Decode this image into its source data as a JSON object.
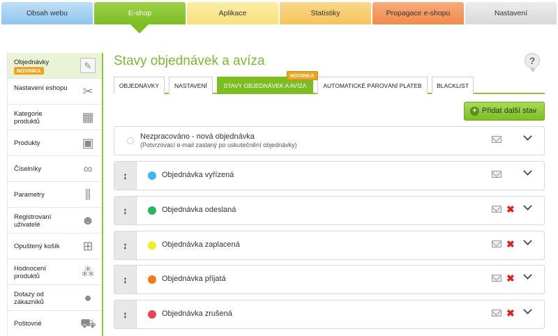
{
  "topnav": [
    {
      "label": "Obsah webu",
      "color": "#8fc4ee"
    },
    {
      "label": "E-shop",
      "color": "#7cbe22",
      "active": true
    },
    {
      "label": "Aplikace",
      "color": "#f7e07a"
    },
    {
      "label": "Statistiky",
      "color": "#f6c45a"
    },
    {
      "label": "Propagace e-shopu",
      "color": "#f28a4c"
    },
    {
      "label": "Nastavení",
      "color": "#d9d9d9"
    }
  ],
  "sidebar": {
    "badge": "NOVINKA",
    "items": [
      {
        "label": "Objednávky",
        "icon": "edit-icon"
      },
      {
        "label": "Nastavení eshopu",
        "icon": "tools-icon"
      },
      {
        "label": "Kategorie produktů",
        "icon": "boxes-icon"
      },
      {
        "label": "Produkty",
        "icon": "product-icon"
      },
      {
        "label": "Číselníky",
        "icon": "binoculars-icon"
      },
      {
        "label": "Parametry",
        "icon": "sliders-icon"
      },
      {
        "label": "Registrovaní uživatelé",
        "icon": "users-icon"
      },
      {
        "label": "Opuštený košík",
        "icon": "basket-icon"
      },
      {
        "label": "Hodnocení produktů",
        "icon": "rating-icon"
      },
      {
        "label": "Dotazy od zákazníků",
        "icon": "chat-icon"
      },
      {
        "label": "Poštovné",
        "icon": "shipping-icon"
      }
    ]
  },
  "main": {
    "title": "Stavy objednávek a avíza",
    "help": "?",
    "tabs": [
      {
        "label": "OBJEDNÁVKY"
      },
      {
        "label": "NASTAVENÍ"
      },
      {
        "label": "STAVY OBJEDNÁVEK A AVÍZA",
        "active": true
      },
      {
        "label": "AUTOMATICKÉ PÁROVÁNÍ PLATEB"
      },
      {
        "label": "BLACKLIST"
      }
    ],
    "tab_badge": "NOVINKA",
    "add_button": "Přidat další stav",
    "first_status": {
      "name": "Nezpracováno - nová objednávka",
      "description": "(Potvrzovací e-mail zaslaný po uskutečnění objednávky)"
    },
    "statuses": [
      {
        "name": "Objednávka vyřízená",
        "color": "#3fb6ee",
        "deletable": false
      },
      {
        "name": "Objednávka odeslaná",
        "color": "#2eb35a",
        "deletable": true
      },
      {
        "name": "Objednávka zaplacená",
        "color": "#f2ec2a",
        "deletable": true
      },
      {
        "name": "Objednávka přijatá",
        "color": "#f07a1c",
        "deletable": true
      },
      {
        "name": "Objednávka zrušená",
        "color": "#e84656",
        "deletable": true
      }
    ]
  }
}
